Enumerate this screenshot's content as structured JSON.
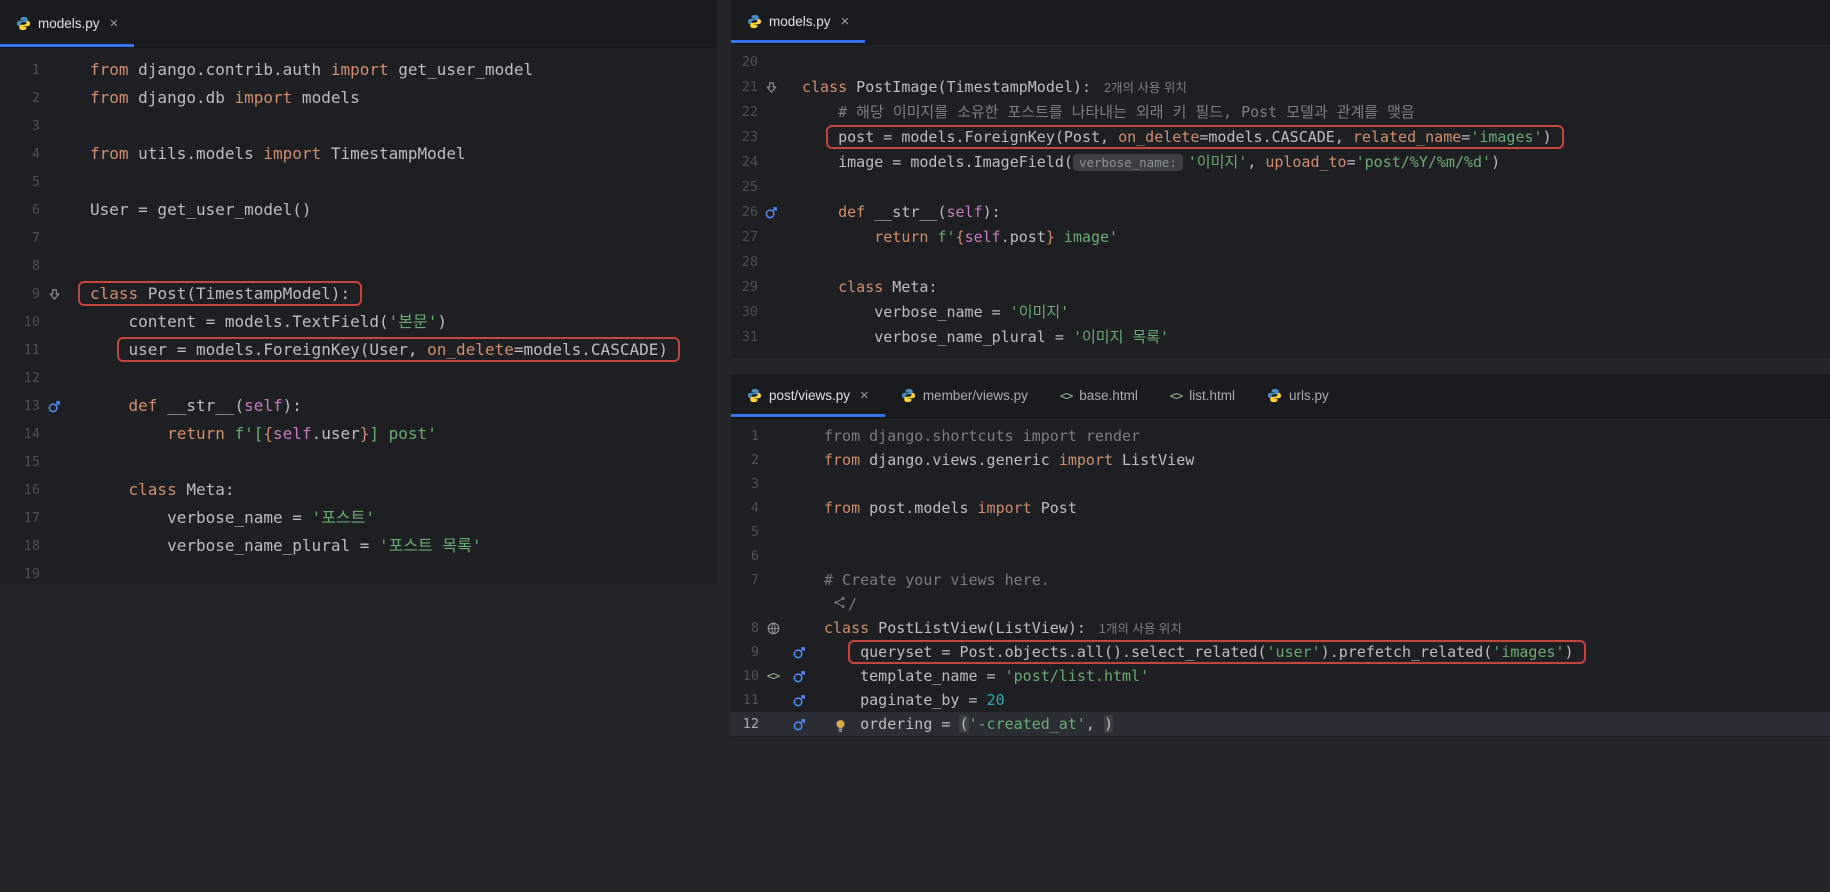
{
  "meta": {
    "theme": "dark",
    "accent_color": "#3574F0",
    "annotation_color": "#C5443C",
    "editor_background": "#1E1F22",
    "keyword_color": "#CF8E6D",
    "string_color": "#6AAB73"
  },
  "panels": [
    {
      "id": "left",
      "name": "models-py-editor",
      "tabs": [
        {
          "label": "models.py",
          "icon": "python",
          "active": true,
          "closable": true
        }
      ],
      "lines": [
        {
          "n": 1,
          "ind": 0,
          "segs": [
            {
              "t": "from",
              "c": "kw"
            },
            {
              "t": " django.contrib.auth ",
              "c": "d"
            },
            {
              "t": "import",
              "c": "kw"
            },
            {
              "t": " get_user_model",
              "c": "d"
            }
          ]
        },
        {
          "n": 2,
          "ind": 0,
          "segs": [
            {
              "t": "from",
              "c": "kw"
            },
            {
              "t": " django.db ",
              "c": "d"
            },
            {
              "t": "import",
              "c": "kw"
            },
            {
              "t": " models",
              "c": "d"
            }
          ]
        },
        {
          "n": 3,
          "ind": 0,
          "segs": []
        },
        {
          "n": 4,
          "ind": 0,
          "segs": [
            {
              "t": "from",
              "c": "kw"
            },
            {
              "t": " utils.models ",
              "c": "d"
            },
            {
              "t": "import",
              "c": "kw"
            },
            {
              "t": " TimestampModel",
              "c": "d"
            }
          ]
        },
        {
          "n": 5,
          "ind": 0,
          "segs": []
        },
        {
          "n": 6,
          "ind": 0,
          "segs": [
            {
              "t": "User = get_user_model()",
              "c": "d"
            }
          ]
        },
        {
          "n": 7,
          "ind": 0,
          "segs": []
        },
        {
          "n": 8,
          "ind": 0,
          "segs": []
        },
        {
          "n": 9,
          "ind": 0,
          "g1": "subclass",
          "box": true,
          "segs": [
            {
              "t": "class",
              "c": "kw"
            },
            {
              "t": " Post(TimestampModel):",
              "c": "d"
            }
          ]
        },
        {
          "n": 10,
          "ind": 4,
          "segs": [
            {
              "t": "content = models.TextField(",
              "c": "d"
            },
            {
              "t": "'본문'",
              "c": "str"
            },
            {
              "t": ")",
              "c": "d"
            }
          ]
        },
        {
          "n": 11,
          "ind": 4,
          "box": true,
          "segs": [
            {
              "t": "user = models.ForeignKey(User, ",
              "c": "d"
            },
            {
              "t": "on_delete",
              "c": "kw"
            },
            {
              "t": "=models.CASCADE)",
              "c": "d"
            }
          ]
        },
        {
          "n": 12,
          "ind": 0,
          "segs": []
        },
        {
          "n": 13,
          "ind": 4,
          "g1": "override",
          "segs": [
            {
              "t": "def",
              "c": "kw"
            },
            {
              "t": " __str__(",
              "c": "d"
            },
            {
              "t": "self",
              "c": "self"
            },
            {
              "t": "):",
              "c": "d"
            }
          ]
        },
        {
          "n": 14,
          "ind": 8,
          "segs": [
            {
              "t": "return",
              "c": "kw"
            },
            {
              "t": " ",
              "c": "d"
            },
            {
              "t": "f'[",
              "c": "str"
            },
            {
              "t": "{",
              "c": "kw"
            },
            {
              "t": "self",
              "c": "self"
            },
            {
              "t": ".user",
              "c": "d"
            },
            {
              "t": "}",
              "c": "kw"
            },
            {
              "t": "] post'",
              "c": "str"
            }
          ]
        },
        {
          "n": 15,
          "ind": 0,
          "segs": []
        },
        {
          "n": 16,
          "ind": 4,
          "segs": [
            {
              "t": "class",
              "c": "kw"
            },
            {
              "t": " Meta:",
              "c": "d"
            }
          ]
        },
        {
          "n": 17,
          "ind": 8,
          "segs": [
            {
              "t": "verbose_name = ",
              "c": "d"
            },
            {
              "t": "'포스트'",
              "c": "str"
            }
          ]
        },
        {
          "n": 18,
          "ind": 8,
          "segs": [
            {
              "t": "verbose_name_plural = ",
              "c": "d"
            },
            {
              "t": "'포스트 목록'",
              "c": "str"
            }
          ]
        },
        {
          "n": 19,
          "ind": 0,
          "segs": []
        }
      ]
    },
    {
      "id": "topright",
      "name": "models-py-postimage-editor",
      "tabs": [
        {
          "label": "models.py",
          "icon": "python",
          "active": true,
          "closable": true
        }
      ],
      "lines": [
        {
          "n": 20,
          "ind": 0,
          "segs": []
        },
        {
          "n": 21,
          "ind": 0,
          "g1": "subclass",
          "segs": [
            {
              "t": "class",
              "c": "kw"
            },
            {
              "t": " PostImage(TimestampModel):",
              "c": "d"
            },
            {
              "t": "2개의 사용 위치",
              "c": "hint"
            }
          ]
        },
        {
          "n": 22,
          "ind": 4,
          "segs": [
            {
              "t": "# 해당 이미지를 소유한 포스트를 나타내는 외래 키 필드, Post 모델과 관계를 맺음",
              "c": "com"
            }
          ]
        },
        {
          "n": 23,
          "ind": 4,
          "box": true,
          "segs": [
            {
              "t": "post = models.ForeignKey(Post, ",
              "c": "d"
            },
            {
              "t": "on_delete",
              "c": "kw"
            },
            {
              "t": "=models.CASCADE, ",
              "c": "d"
            },
            {
              "t": "related_name",
              "c": "kw"
            },
            {
              "t": "=",
              "c": "d"
            },
            {
              "t": "'images'",
              "c": "str"
            },
            {
              "t": ")",
              "c": "d"
            }
          ]
        },
        {
          "n": 24,
          "ind": 4,
          "segs": [
            {
              "t": "image = models.ImageField(",
              "c": "d"
            },
            {
              "t": "verbose_name:",
              "c": "phint"
            },
            {
              "t": "'이미지'",
              "c": "str"
            },
            {
              "t": ", ",
              "c": "d"
            },
            {
              "t": "upload_to",
              "c": "kw"
            },
            {
              "t": "=",
              "c": "d"
            },
            {
              "t": "'post/%Y/%m/%d'",
              "c": "str"
            },
            {
              "t": ")",
              "c": "d"
            }
          ]
        },
        {
          "n": 25,
          "ind": 0,
          "segs": []
        },
        {
          "n": 26,
          "ind": 4,
          "g1": "override",
          "segs": [
            {
              "t": "def",
              "c": "kw"
            },
            {
              "t": " __str__(",
              "c": "d"
            },
            {
              "t": "self",
              "c": "self"
            },
            {
              "t": "):",
              "c": "d"
            }
          ]
        },
        {
          "n": 27,
          "ind": 8,
          "segs": [
            {
              "t": "return",
              "c": "kw"
            },
            {
              "t": " ",
              "c": "d"
            },
            {
              "t": "f'",
              "c": "str"
            },
            {
              "t": "{",
              "c": "kw"
            },
            {
              "t": "self",
              "c": "self"
            },
            {
              "t": ".post",
              "c": "d"
            },
            {
              "t": "}",
              "c": "kw"
            },
            {
              "t": " image'",
              "c": "str"
            }
          ]
        },
        {
          "n": 28,
          "ind": 0,
          "segs": []
        },
        {
          "n": 29,
          "ind": 4,
          "segs": [
            {
              "t": "class",
              "c": "kw"
            },
            {
              "t": " Meta:",
              "c": "d"
            }
          ]
        },
        {
          "n": 30,
          "ind": 8,
          "segs": [
            {
              "t": "verbose_name = ",
              "c": "d"
            },
            {
              "t": "'이미지'",
              "c": "str"
            }
          ]
        },
        {
          "n": 31,
          "ind": 8,
          "segs": [
            {
              "t": "verbose_name_plural = ",
              "c": "d"
            },
            {
              "t": "'이미지 목록'",
              "c": "str"
            }
          ]
        }
      ]
    },
    {
      "id": "bottomright",
      "name": "post-views-py-editor",
      "tabs": [
        {
          "label": "post/views.py",
          "icon": "python",
          "active": true,
          "closable": true
        },
        {
          "label": "member/views.py",
          "icon": "python"
        },
        {
          "label": "base.html",
          "icon": "html"
        },
        {
          "label": "list.html",
          "icon": "html"
        },
        {
          "label": "urls.py",
          "icon": "python"
        }
      ],
      "lines": [
        {
          "n": 1,
          "ind": 0,
          "segs": [
            {
              "t": "from django.shortcuts import render",
              "c": "com"
            }
          ]
        },
        {
          "n": 2,
          "ind": 0,
          "segs": [
            {
              "t": "from",
              "c": "kw"
            },
            {
              "t": " django.views.generic ",
              "c": "d"
            },
            {
              "t": "import",
              "c": "kw"
            },
            {
              "t": " ListView",
              "c": "d"
            }
          ]
        },
        {
          "n": 3,
          "ind": 0,
          "segs": []
        },
        {
          "n": 4,
          "ind": 0,
          "segs": [
            {
              "t": "from",
              "c": "kw"
            },
            {
              "t": " post.models ",
              "c": "d"
            },
            {
              "t": "import",
              "c": "kw"
            },
            {
              "t": " Post",
              "c": "d"
            }
          ]
        },
        {
          "n": 5,
          "ind": 0,
          "segs": []
        },
        {
          "n": 6,
          "ind": 0,
          "segs": []
        },
        {
          "n": 7,
          "ind": 0,
          "segs": [
            {
              "t": "# Create your views here.",
              "c": "com"
            }
          ]
        },
        {
          "inlay": true,
          "ind": 0,
          "segs": [
            {
              "t": "/",
              "c": "com"
            }
          ]
        },
        {
          "n": 8,
          "ind": 0,
          "g1": "globe",
          "segs": [
            {
              "t": "class",
              "c": "kw"
            },
            {
              "t": " PostListView(ListView):",
              "c": "d"
            },
            {
              "t": "1개의 사용 위치",
              "c": "hint"
            }
          ]
        },
        {
          "n": 9,
          "ind": 4,
          "g2": "override",
          "box": true,
          "segs": [
            {
              "t": "queryset = Post.objects.all().select_related(",
              "c": "d"
            },
            {
              "t": "'user'",
              "c": "str"
            },
            {
              "t": ").prefetch_related(",
              "c": "d"
            },
            {
              "t": "'images'",
              "c": "str"
            },
            {
              "t": ")",
              "c": "d"
            }
          ]
        },
        {
          "n": 10,
          "ind": 4,
          "g1": "html",
          "g2": "override",
          "segs": [
            {
              "t": "template_name = ",
              "c": "d"
            },
            {
              "t": "'post/list.html'",
              "c": "str"
            }
          ]
        },
        {
          "n": 11,
          "ind": 4,
          "g2": "override",
          "segs": [
            {
              "t": "paginate_by = ",
              "c": "d"
            },
            {
              "t": "20",
              "c": "num"
            }
          ]
        },
        {
          "n": 12,
          "ind": 4,
          "g2": "override",
          "current": true,
          "bulb": true,
          "segs": [
            {
              "t": "ordering = ",
              "c": "d"
            },
            {
              "t": "(",
              "c": "pm"
            },
            {
              "t": "'-created_at'",
              "c": "str"
            },
            {
              "t": ", ",
              "c": "d"
            },
            {
              "t": ")",
              "c": "pm"
            }
          ]
        }
      ]
    }
  ]
}
